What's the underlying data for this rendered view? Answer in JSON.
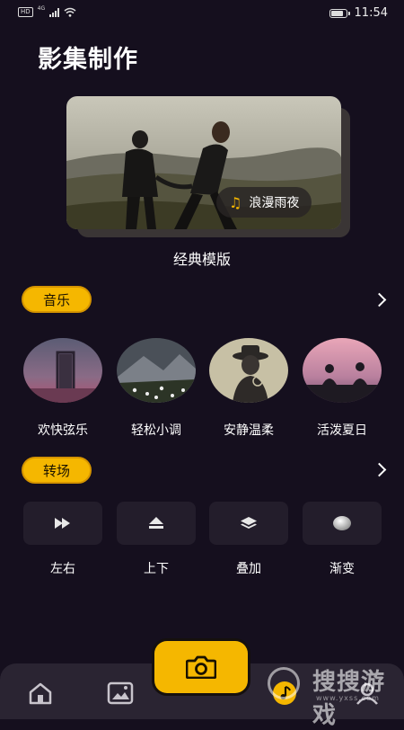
{
  "status_bar": {
    "hd": "HD",
    "network": "4G",
    "time": "11:54",
    "battery_level": 0.85
  },
  "page": {
    "title": "影集制作"
  },
  "template_card": {
    "song_label": "浪漫雨夜",
    "caption": "经典模版"
  },
  "music_section": {
    "label": "音乐",
    "items": [
      {
        "label": "欢快弦乐"
      },
      {
        "label": "轻松小调"
      },
      {
        "label": "安静温柔"
      },
      {
        "label": "活泼夏日"
      }
    ]
  },
  "transition_section": {
    "label": "转场",
    "items": [
      {
        "label": "左右",
        "icon": "fast-forward-icon"
      },
      {
        "label": "上下",
        "icon": "eject-up-icon"
      },
      {
        "label": "叠加",
        "icon": "layers-icon"
      },
      {
        "label": "渐变",
        "icon": "gradient-sphere-icon"
      }
    ]
  },
  "bottom_nav": {
    "items": [
      {
        "icon": "home-icon"
      },
      {
        "icon": "image-icon"
      },
      {
        "icon": "camera-icon"
      },
      {
        "icon": "music-note-icon"
      },
      {
        "icon": "profile-icon"
      }
    ]
  },
  "watermark": {
    "text": "搜搜游戏",
    "url": "www.yxss.com"
  },
  "colors": {
    "accent": "#f5b700",
    "background": "#150f1e",
    "tile": "#231d2b",
    "nav": "#2a2432"
  }
}
